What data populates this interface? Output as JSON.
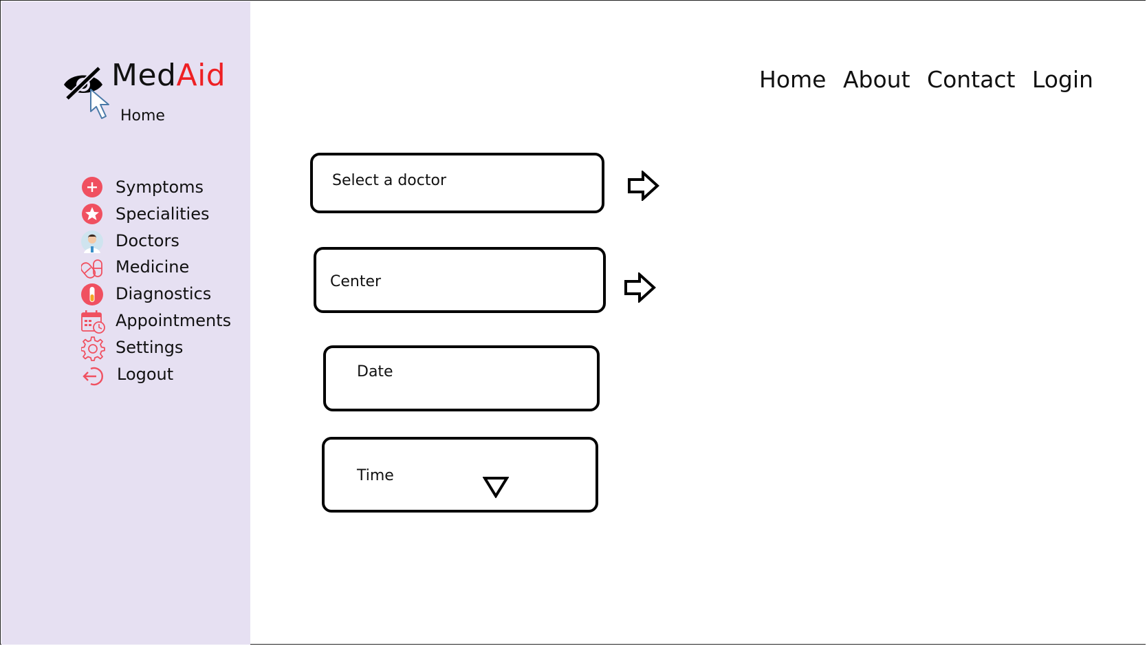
{
  "brand": {
    "name_part1": "Med",
    "name_part2": "Aid",
    "subtitle": "Home"
  },
  "sidebar": {
    "items": [
      {
        "label": "Symptoms",
        "icon": "plus-circle-icon"
      },
      {
        "label": "Specialities",
        "icon": "star-badge-icon"
      },
      {
        "label": "Doctors",
        "icon": "doctor-avatar-icon"
      },
      {
        "label": "Medicine",
        "icon": "pills-icon"
      },
      {
        "label": "Diagnostics",
        "icon": "test-tube-icon"
      },
      {
        "label": "Appointments",
        "icon": "calendar-clock-icon"
      },
      {
        "label": "Settings",
        "icon": "gear-icon"
      },
      {
        "label": "Logout",
        "icon": "logout-icon"
      }
    ]
  },
  "topnav": {
    "items": [
      "Home",
      "About",
      "Contact",
      "Login"
    ]
  },
  "form": {
    "doctor_label": "Select a doctor",
    "center_label": "Center",
    "date_label": "Date",
    "time_label": "Time"
  },
  "colors": {
    "sidebar_bg": "#e6e0f2",
    "accent_red": "#ee2024",
    "icon_red": "#f05060"
  }
}
